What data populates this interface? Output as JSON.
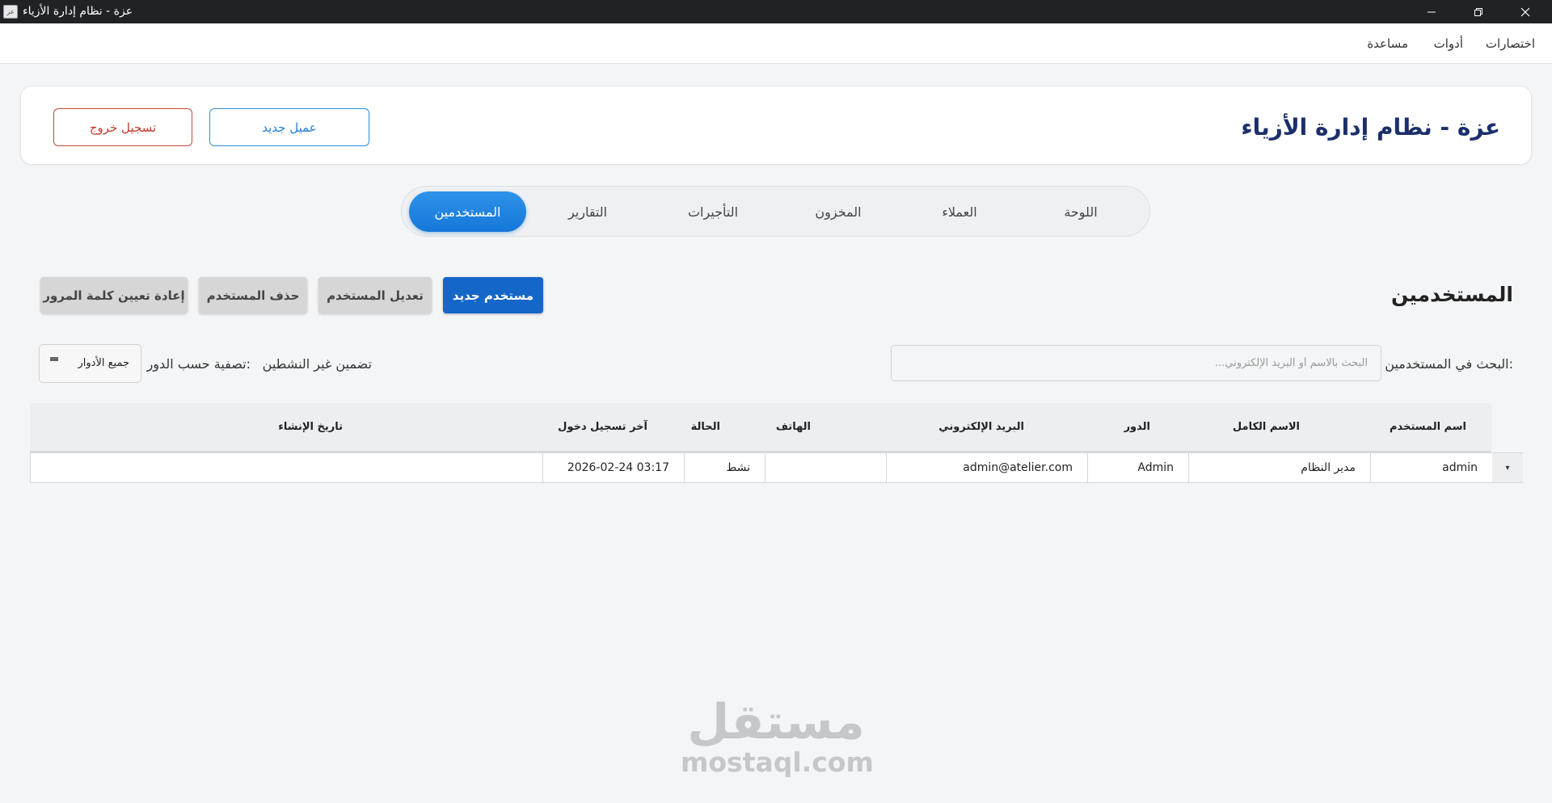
{
  "window": {
    "title": "عزة - نظام إدارة الأزياء",
    "icon_text": "عز"
  },
  "menu": {
    "items": [
      "اختصارات",
      "أدوات",
      "مساعدة"
    ]
  },
  "header": {
    "title": "عزة - نظام إدارة الأزياء",
    "new_client_label": "عميل جديد",
    "logout_label": "تسجيل خروج"
  },
  "tabs": {
    "items": [
      "اللوحة",
      "العملاء",
      "المخزون",
      "التأجيرات",
      "التقارير",
      "المستخدمين"
    ],
    "active": "المستخدمين"
  },
  "users": {
    "section_title": "المستخدمين",
    "new_user_label": "مستخدم جديد",
    "edit_user_label": "تعديل المستخدم",
    "delete_user_label": "حذف المستخدم",
    "reset_password_label": "إعادة تعيين كلمة المرور",
    "search_label": "البحث في المستخدمين:",
    "search_placeholder": "البحث بالاسم أو البريد الإلكتروني...",
    "search_value": "",
    "include_inactive_label": "تضمين غير النشطين",
    "filter_label": "تصفية حسب الدور:",
    "role_filter_value": "جميع الأدوار"
  },
  "table": {
    "columns": [
      "اسم المستخدم",
      "الاسم الكامل",
      "الدور",
      "البريد الإلكتروني",
      "الهاتف",
      "الحالة",
      "آخر تسجيل دخول",
      "تاريخ الإنشاء"
    ],
    "rows": [
      {
        "username": "admin",
        "full_name": "مدير النظام",
        "role": "Admin",
        "email": "admin@atelier.com",
        "phone": "",
        "status": "نشط",
        "last_login": "2026-02-24 03:17",
        "created": ""
      }
    ]
  },
  "watermark": {
    "arabic": "مستقل",
    "latin": "mostaql.com"
  },
  "colors": {
    "primary": "#1466c8",
    "accent_tab": "#1e82e0",
    "danger": "#c0392b",
    "title": "#1c2f6b"
  }
}
